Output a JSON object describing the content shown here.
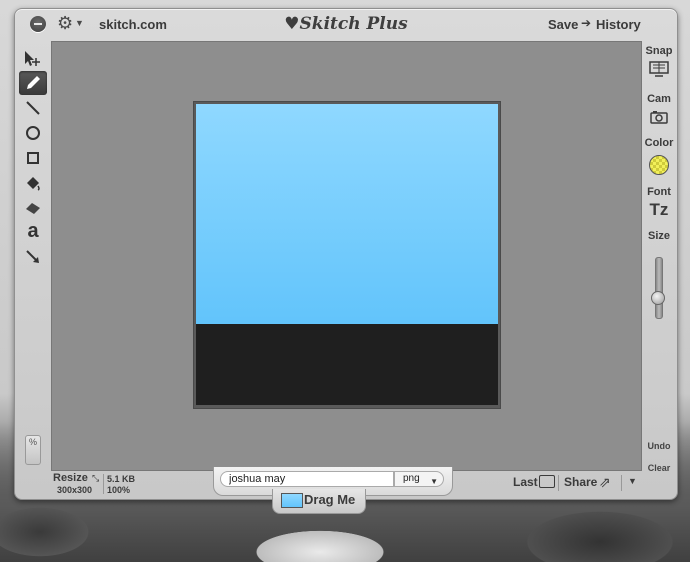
{
  "window": {
    "site": "skitch.com",
    "title": "♥Skitch Plus",
    "save": "Save",
    "history": "History"
  },
  "tools": [
    {
      "name": "select-move-tool",
      "icon": "arrow-move-icon"
    },
    {
      "name": "pencil-tool",
      "icon": "pencil-icon",
      "active": true
    },
    {
      "name": "line-tool",
      "icon": "line-icon"
    },
    {
      "name": "ellipse-tool",
      "icon": "circle-icon"
    },
    {
      "name": "rectangle-tool",
      "icon": "square-icon"
    },
    {
      "name": "fill-tool",
      "icon": "paint-bucket-icon"
    },
    {
      "name": "eraser-tool",
      "icon": "eraser-icon"
    },
    {
      "name": "text-tool",
      "icon": "text-a-icon",
      "glyph": "a"
    },
    {
      "name": "arrow-tool",
      "icon": "arrow-icon"
    }
  ],
  "percent_label": "%",
  "right_panel": {
    "snap": "Snap",
    "cam": "Cam",
    "color": "Color",
    "font": "Font",
    "font_glyph": "Tz",
    "size": "Size",
    "size_level": 0.3,
    "undo": "Undo",
    "clear": "Clear"
  },
  "bottom": {
    "resize": "Resize",
    "dims": "300x300",
    "file_size": "5.1 KB",
    "zoom": "100%",
    "filename": "joshua may",
    "format": "png",
    "drag_me": "Drag Me",
    "last": "Last",
    "share": "Share"
  },
  "colors": {
    "sky_top": "#8fd8ff",
    "sky_bottom": "#62c4fb",
    "ground": "#1f1f1f",
    "swatch": "#f2f05a"
  }
}
